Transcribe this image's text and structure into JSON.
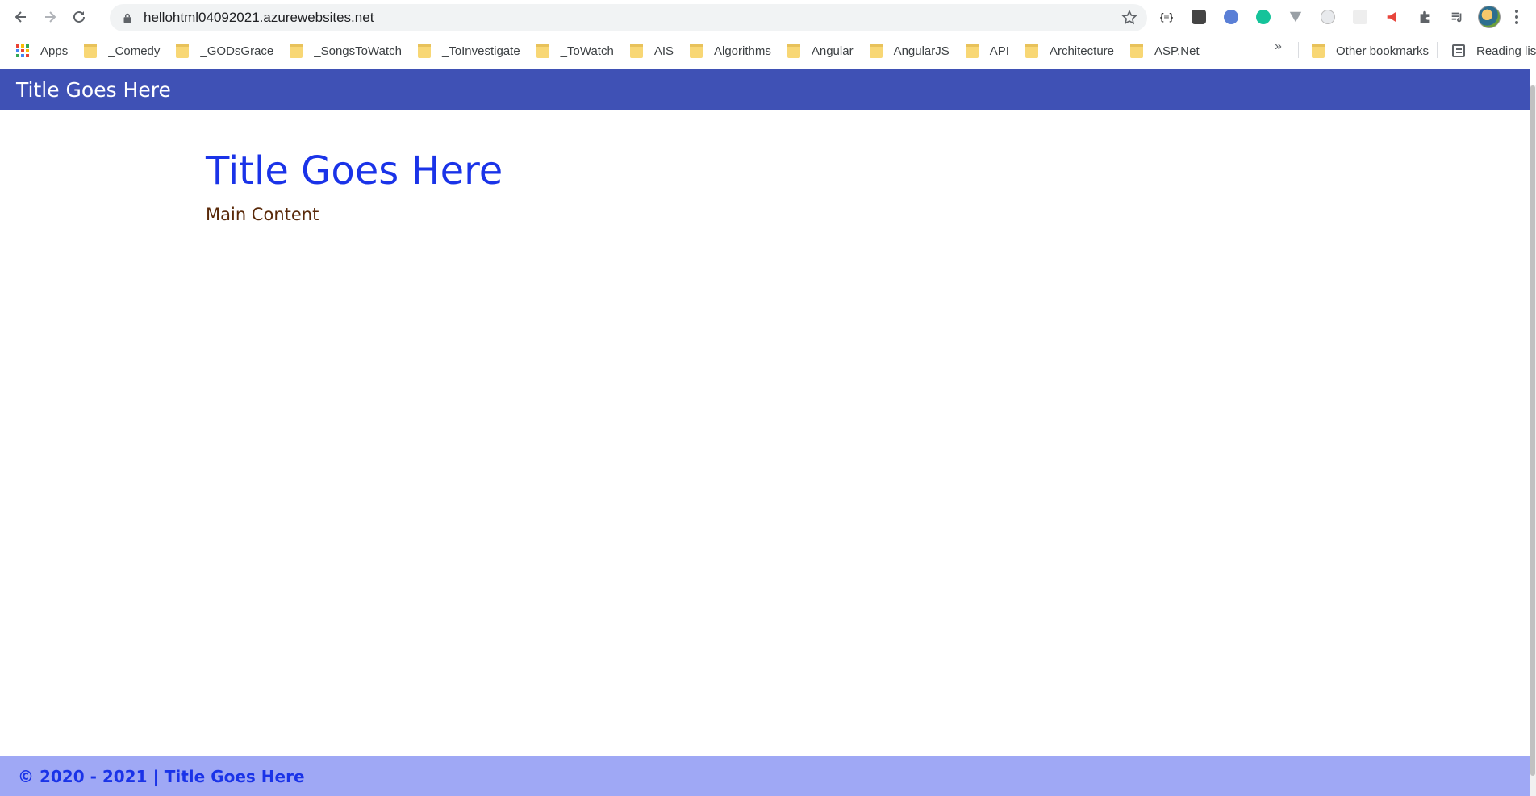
{
  "browser": {
    "url": "hellohtml04092021.azurewebsites.net",
    "bookmarks": [
      {
        "label": "Apps",
        "type": "apps"
      },
      {
        "label": "_Comedy",
        "type": "folder"
      },
      {
        "label": "_GODsGrace",
        "type": "folder"
      },
      {
        "label": "_SongsToWatch",
        "type": "folder"
      },
      {
        "label": "_ToInvestigate",
        "type": "folder"
      },
      {
        "label": "_ToWatch",
        "type": "folder"
      },
      {
        "label": "AIS",
        "type": "folder"
      },
      {
        "label": "Algorithms",
        "type": "folder"
      },
      {
        "label": "Angular",
        "type": "folder"
      },
      {
        "label": "AngularJS",
        "type": "folder"
      },
      {
        "label": "API",
        "type": "folder"
      },
      {
        "label": "Architecture",
        "type": "folder"
      },
      {
        "label": "ASP.Net",
        "type": "folder"
      }
    ],
    "overflow_label": "»",
    "other_bookmarks_label": "Other bookmarks",
    "reading_list_label": "Reading list",
    "extensions_glyph": "{≡}"
  },
  "page": {
    "header_title": "Title Goes Here",
    "main_title": "Title Goes Here",
    "main_content": "Main Content",
    "footer_text": "© 2020 - 2021 | Title Goes Here"
  },
  "colors": {
    "header_bg": "#3f51b5",
    "footer_bg": "#9fa8f5",
    "title_color": "#1a33e8"
  }
}
